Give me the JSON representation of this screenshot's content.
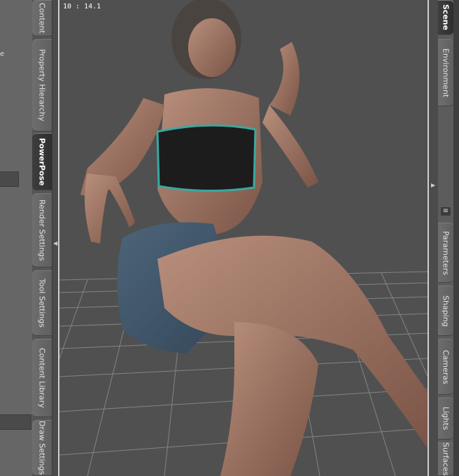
{
  "viewport": {
    "frame_counter": "10 : 14.1"
  },
  "left_panel": {
    "fragment_text": "e"
  },
  "left_tabs": [
    {
      "label": "Content",
      "active": false
    },
    {
      "label": "Property Hierarchy",
      "active": false
    },
    {
      "label": "PowerPose",
      "active": true
    },
    {
      "label": "Render Settings",
      "active": false
    },
    {
      "label": "Tool Settings",
      "active": false
    },
    {
      "label": "Content Library",
      "active": false
    },
    {
      "label": "Draw Settings",
      "active": false
    }
  ],
  "right_tabs": [
    {
      "label": "Scene",
      "active": true
    },
    {
      "label": "Environment",
      "active": false
    },
    {
      "label": "Parameters",
      "active": false
    },
    {
      "label": "Shaping",
      "active": false
    },
    {
      "label": "Cameras",
      "active": false
    },
    {
      "label": "Lights",
      "active": false
    },
    {
      "label": "Surfaces",
      "active": false
    }
  ],
  "icons": {
    "splitter_arrow_left": "chevron-left-icon",
    "splitter_arrow_right": "chevron-right-icon",
    "panel_menu": "menu-icon"
  },
  "colors": {
    "viewport_bg": "#505050",
    "grid_line": "#8a8a8a",
    "active_tab": "#333333",
    "tab": "#666666",
    "frame_border": "#cfcfcf"
  }
}
